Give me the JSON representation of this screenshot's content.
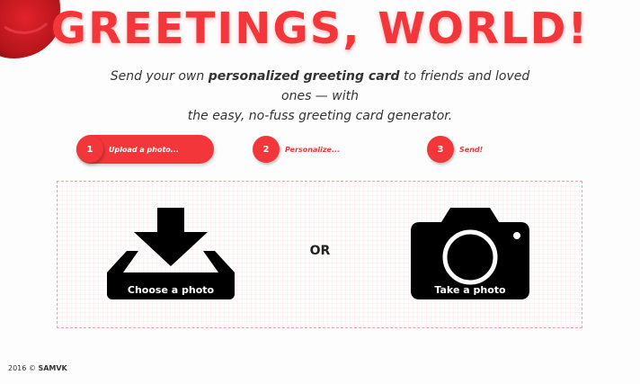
{
  "header": {
    "title": "GREETINGS, WORLD!",
    "subtitle_pre": "Send your own ",
    "subtitle_bold": "personalized greeting card",
    "subtitle_mid": " to friends and loved ones — with",
    "subtitle_line2": "the easy, no-fuss greeting card generator."
  },
  "steps": [
    {
      "number": "1",
      "label": "Upload a photo...",
      "active": true
    },
    {
      "number": "2",
      "label": "Personalize...",
      "active": false
    },
    {
      "number": "3",
      "label": "Send!",
      "active": false
    }
  ],
  "upload": {
    "choose_label": "Choose a photo",
    "choose_icon": "download-tray-icon",
    "or_label": "OR",
    "take_label": "Take a photo",
    "take_icon": "camera-icon"
  },
  "footer": {
    "year": "2016 ©",
    "author": "SAMVK"
  },
  "colors": {
    "accent": "#f2363a",
    "icon": "#000000",
    "seal": "#c4151c"
  }
}
